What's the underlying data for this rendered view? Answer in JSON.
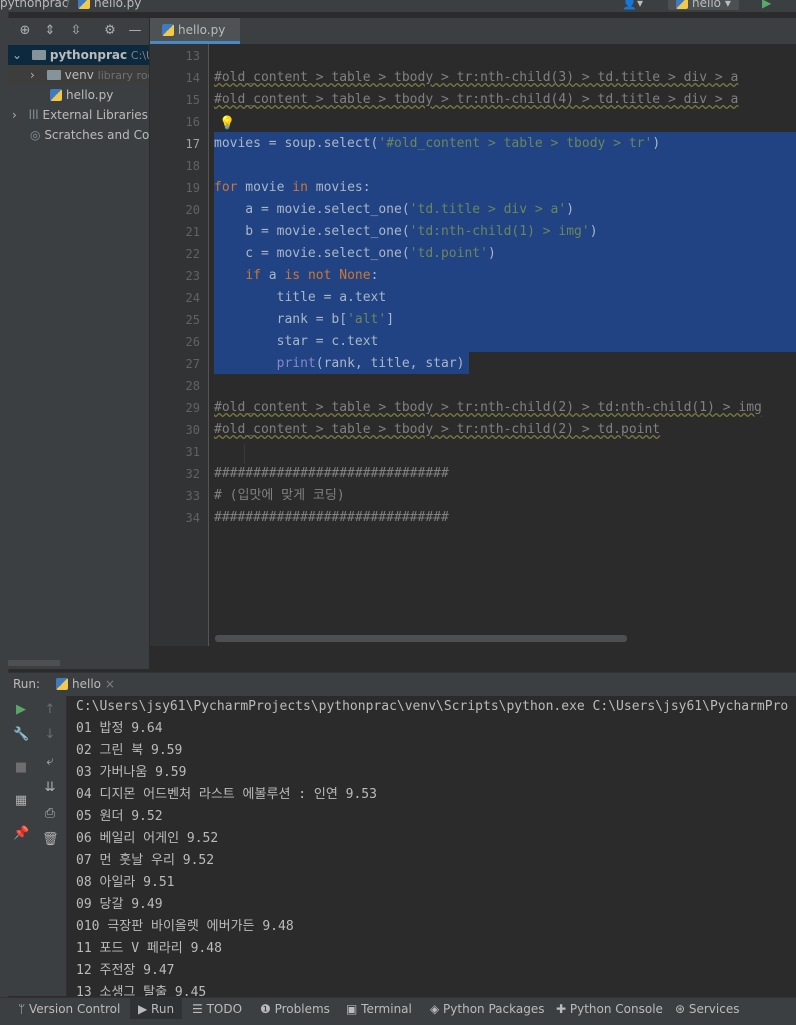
{
  "navbar": {
    "project": "pythonprac",
    "file": "hello.py",
    "run_config": "hello"
  },
  "project_panel": {
    "items": [
      {
        "label": "pythonprac",
        "hint": "C:\\U"
      },
      {
        "label": "venv",
        "hint": "library roo"
      },
      {
        "label": "hello.py"
      },
      {
        "label": "External Libraries"
      },
      {
        "label": "Scratches and Con"
      }
    ]
  },
  "editor": {
    "tab": "hello.py",
    "lines": [
      {
        "n": "13",
        "text": ""
      },
      {
        "n": "14",
        "text": "#old_content > table > tbody > tr:nth-child(3) > td.title > div > a"
      },
      {
        "n": "15",
        "text": "#old_content > table > tbody > tr:nth-child(4) > td.title > div > a"
      },
      {
        "n": "16",
        "text": ""
      },
      {
        "n": "17",
        "text": "movies = soup.select('#old_content > table > tbody > tr')"
      },
      {
        "n": "18",
        "text": ""
      },
      {
        "n": "19",
        "text": "for movie in movies:"
      },
      {
        "n": "20",
        "text": "    a = movie.select_one('td.title > div > a')"
      },
      {
        "n": "21",
        "text": "    b = movie.select_one('td:nth-child(1) > img')"
      },
      {
        "n": "22",
        "text": "    c = movie.select_one('td.point')"
      },
      {
        "n": "23",
        "text": "    if a is not None:"
      },
      {
        "n": "24",
        "text": "        title = a.text"
      },
      {
        "n": "25",
        "text": "        rank = b['alt']"
      },
      {
        "n": "26",
        "text": "        star = c.text"
      },
      {
        "n": "27",
        "text": "        print(rank, title, star)"
      },
      {
        "n": "28",
        "text": ""
      },
      {
        "n": "29",
        "text": "#old_content > table > tbody > tr:nth-child(2) > td:nth-child(1) > img"
      },
      {
        "n": "30",
        "text": "#old_content > table > tbody > tr:nth-child(2) > td.point"
      },
      {
        "n": "31",
        "text": ""
      },
      {
        "n": "32",
        "text": "##############################"
      },
      {
        "n": "33",
        "text": "# (입맛에 맞게 코딩)"
      },
      {
        "n": "34",
        "text": "##############################"
      }
    ]
  },
  "run": {
    "label": "Run:",
    "tab": "hello",
    "output": [
      "C:\\Users\\jsy61\\PycharmProjects\\pythonprac\\venv\\Scripts\\python.exe C:\\Users\\jsy61\\PycharmPro",
      "01 밥정 9.64",
      "02 그린 북 9.59",
      "03 가버나움 9.59",
      "04 디지몬 어드벤처 라스트 에볼루션 : 인연 9.53",
      "05 원더 9.52",
      "06 베일리 어게인 9.52",
      "07 먼 훗날 우리 9.52",
      "08 아일라 9.51",
      "09 당갈 9.49",
      "010 극장판 바이올렛 에버가든 9.48",
      "11 포드 V 페라리 9.48",
      "12 주전장 9.47",
      "13 소생그 탈출 9.45"
    ]
  },
  "bottom_tabs": [
    "Version Control",
    "Run",
    "TODO",
    "Problems",
    "Terminal",
    "Python Packages",
    "Python Console",
    "Services"
  ],
  "colors": {
    "selection": "#214283",
    "keyword": "#cc7832",
    "string": "#6a8759",
    "background": "#2b2b2b"
  }
}
